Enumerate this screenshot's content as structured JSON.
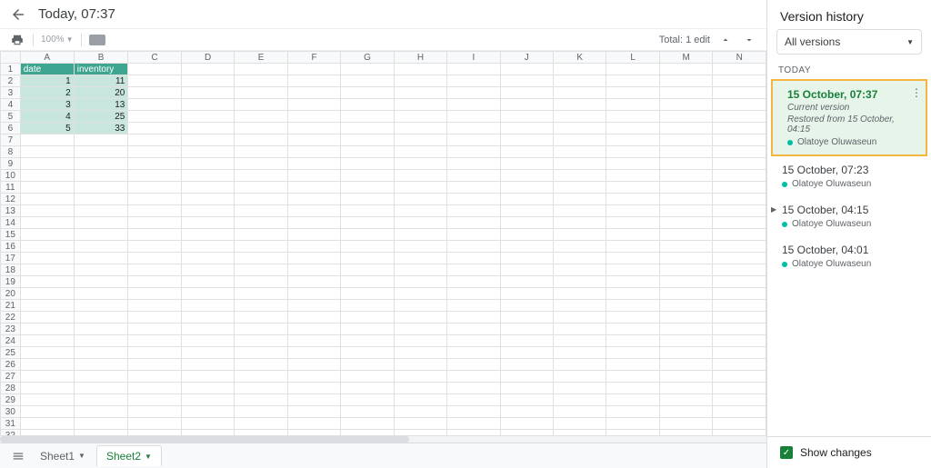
{
  "header": {
    "title": "Today, 07:37"
  },
  "toolbar": {
    "zoom": "100%",
    "edits": "Total: 1 edit"
  },
  "columns": [
    "A",
    "B",
    "C",
    "D",
    "E",
    "F",
    "G",
    "H",
    "I",
    "J",
    "K",
    "L",
    "M",
    "N"
  ],
  "rows": 33,
  "data_header": {
    "a": "date",
    "b": "inventory"
  },
  "data_rows": [
    {
      "a": "1",
      "b": "11"
    },
    {
      "a": "2",
      "b": "20"
    },
    {
      "a": "3",
      "b": "13"
    },
    {
      "a": "4",
      "b": "25"
    },
    {
      "a": "5",
      "b": "33"
    }
  ],
  "tabs": {
    "sheet1": "Sheet1",
    "sheet2": "Sheet2"
  },
  "panel": {
    "title": "Version history",
    "dropdown": "All versions",
    "section": "TODAY",
    "show_changes": "Show changes"
  },
  "versions": [
    {
      "title": "15 October, 07:37",
      "sub1": "Current version",
      "sub2": "Restored from 15 October, 04:15",
      "author": "Olatoye Oluwaseun",
      "current": true,
      "more": true
    },
    {
      "title": "15 October, 07:23",
      "author": "Olatoye Oluwaseun"
    },
    {
      "title": "15 October, 04:15",
      "author": "Olatoye Oluwaseun",
      "expandable": true
    },
    {
      "title": "15 October, 04:01",
      "author": "Olatoye Oluwaseun"
    }
  ]
}
